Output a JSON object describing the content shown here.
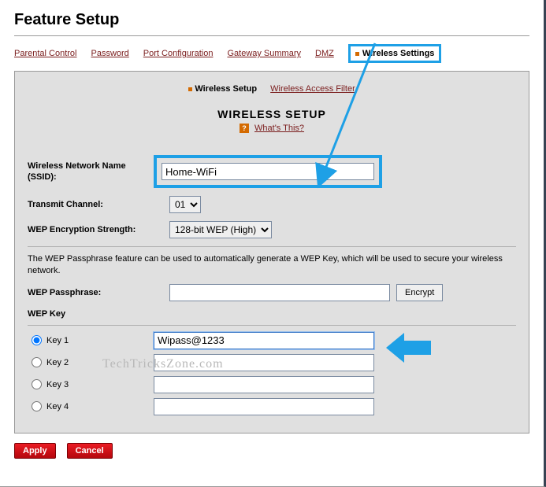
{
  "page_title": "Feature Setup",
  "tabs": {
    "parental": "Parental Control",
    "password": "Password",
    "portconfig": "Port Configuration",
    "gateway": "Gateway Summary",
    "dmz": "DMZ",
    "wireless": "Wireless Settings"
  },
  "panel_tabs": {
    "setup": "Wireless Setup",
    "filter": "Wireless Access Filter"
  },
  "section_heading": "WIRELESS SETUP",
  "whats_this": "What's This?",
  "labels": {
    "ssid": "Wireless Network Name (SSID):",
    "channel": "Transmit Channel:",
    "wep_strength": "WEP Encryption Strength:",
    "wep_pass_help": "The WEP Passphrase feature can be used to automatically generate a WEP Key, which will be used to secure your wireless network.",
    "wep_passphrase": "WEP Passphrase:",
    "wep_key_header": "WEP Key",
    "key1": "Key 1",
    "key2": "Key 2",
    "key3": "Key 3",
    "key4": "Key 4"
  },
  "values": {
    "ssid": "Home-WiFi",
    "channel": "01",
    "wep_strength": "128-bit WEP (High)",
    "wep_passphrase": "",
    "key1": "Wipass@1233",
    "key2": "",
    "key3": "",
    "key4": ""
  },
  "buttons": {
    "encrypt": "Encrypt",
    "apply": "Apply",
    "cancel": "Cancel"
  },
  "watermark": "TechTricksZone.com"
}
